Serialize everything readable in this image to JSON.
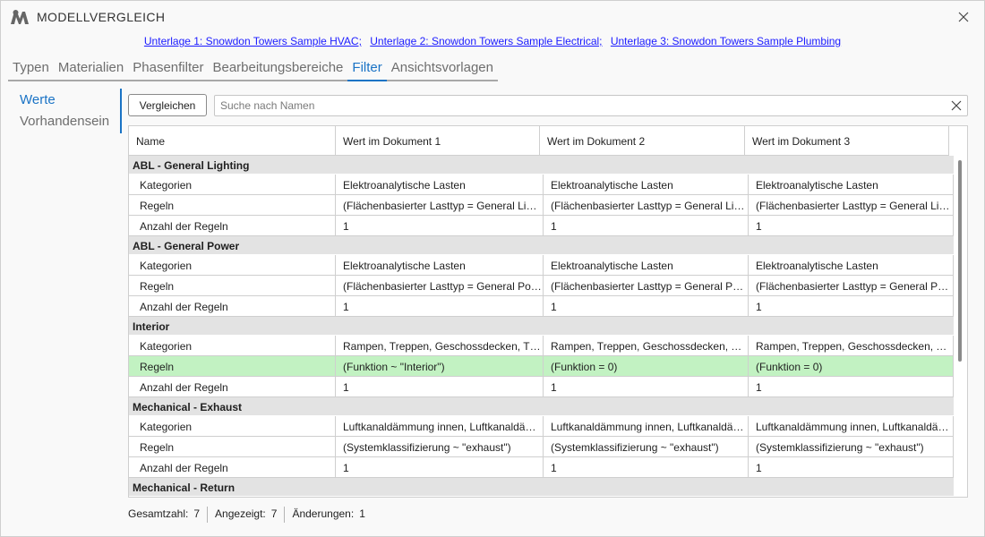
{
  "app": {
    "title": "MODELLVERGLEICH"
  },
  "documents": [
    "Unterlage 1: Snowdon Towers Sample HVAC;",
    "Unterlage 2: Snowdon Towers Sample Electrical;",
    "Unterlage 3: Snowdon Towers Sample Plumbing"
  ],
  "tabs": [
    {
      "label": "Typen",
      "active": false
    },
    {
      "label": "Materialien",
      "active": false
    },
    {
      "label": "Phasenfilter",
      "active": false
    },
    {
      "label": "Bearbeitungsbereiche",
      "active": false
    },
    {
      "label": "Filter",
      "active": true
    },
    {
      "label": "Ansichtsvorlagen",
      "active": false
    }
  ],
  "sidenav": [
    {
      "label": "Werte",
      "active": true
    },
    {
      "label": "Vorhandensein",
      "active": false
    }
  ],
  "toolbar": {
    "compare_label": "Vergleichen",
    "search_placeholder": "Suche nach Namen",
    "search_value": ""
  },
  "table": {
    "columns": [
      "Name",
      "Wert im Dokument 1",
      "Wert im Dokument 2",
      "Wert im Dokument 3"
    ],
    "groups": [
      {
        "name": "ABL - General Lighting",
        "rows": [
          {
            "name": "Kategorien",
            "values": [
              "Elektroanalytische Lasten",
              "Elektroanalytische Lasten",
              "Elektroanalytische Lasten"
            ],
            "changed": false
          },
          {
            "name": "Regeln",
            "values": [
              "(Flächenbasierter Lasttyp = General Lig…",
              "(Flächenbasierter Lasttyp = General Lig…",
              "(Flächenbasierter Lasttyp = General Lig…"
            ],
            "changed": false
          },
          {
            "name": "Anzahl der Regeln",
            "values": [
              "1",
              "1",
              "1"
            ],
            "changed": false
          }
        ]
      },
      {
        "name": "ABL - General Power",
        "rows": [
          {
            "name": "Kategorien",
            "values": [
              "Elektroanalytische Lasten",
              "Elektroanalytische Lasten",
              "Elektroanalytische Lasten"
            ],
            "changed": false
          },
          {
            "name": "Regeln",
            "values": [
              "(Flächenbasierter Lasttyp = General Po…",
              "(Flächenbasierter Lasttyp = General Po…",
              "(Flächenbasierter Lasttyp = General Po…"
            ],
            "changed": false
          },
          {
            "name": "Anzahl der Regeln",
            "values": [
              "1",
              "1",
              "1"
            ],
            "changed": false
          }
        ]
      },
      {
        "name": "Interior",
        "rows": [
          {
            "name": "Kategorien",
            "values": [
              "Rampen, Treppen, Geschossdecken, Tür…",
              "Rampen, Treppen, Geschossdecken, Tür…",
              "Rampen, Treppen, Geschossdecken, Tür…"
            ],
            "changed": false
          },
          {
            "name": "Regeln",
            "values": [
              "(Funktion ~ \"Interior\")",
              "(Funktion = 0)",
              "(Funktion = 0)"
            ],
            "changed": true
          },
          {
            "name": "Anzahl der Regeln",
            "values": [
              "1",
              "1",
              "1"
            ],
            "changed": false
          }
        ]
      },
      {
        "name": "Mechanical - Exhaust",
        "rows": [
          {
            "name": "Kategorien",
            "values": [
              "Luftkanaldämmung innen, Luftkanaldä…",
              "Luftkanaldämmung innen, Luftkanaldä…",
              "Luftkanaldämmung innen, Luftkanaldä…"
            ],
            "changed": false
          },
          {
            "name": "Regeln",
            "values": [
              "(Systemklassifizierung ~ \"exhaust\")",
              "(Systemklassifizierung ~ \"exhaust\")",
              "(Systemklassifizierung ~ \"exhaust\")"
            ],
            "changed": false
          },
          {
            "name": "Anzahl der Regeln",
            "values": [
              "1",
              "1",
              "1"
            ],
            "changed": false
          }
        ]
      },
      {
        "name": "Mechanical - Return",
        "rows": [
          {
            "name": "",
            "values": [
              "",
              "",
              ""
            ],
            "changed": false
          }
        ]
      }
    ]
  },
  "status": {
    "total_label": "Gesamtzahl:",
    "total_value": "7",
    "shown_label": "Angezeigt:",
    "shown_value": "7",
    "changes_label": "Änderungen:",
    "changes_value": "1"
  },
  "colors": {
    "accent": "#1a73c5",
    "changed_row": "#c2f2c2",
    "group_row": "#e3e3e3",
    "link": "#1a1aff"
  }
}
